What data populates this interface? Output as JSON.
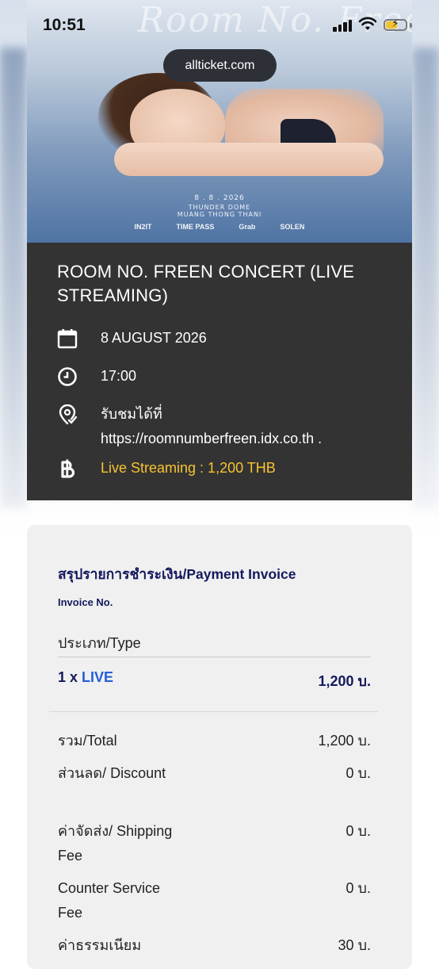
{
  "status_bar": {
    "time": "10:51"
  },
  "browser": {
    "url": "allticket.com"
  },
  "poster": {
    "title_art": "Room No. Freen",
    "date_line1": "8 . 8 . 2026",
    "date_line2": "THUNDER DOME",
    "date_line3": "MUANG THONG THANI",
    "sponsors": [
      "IN2IT",
      "TIME PASS",
      "Grab",
      "SOLEN"
    ]
  },
  "event": {
    "title": "ROOM NO. FREEN CONCERT (LIVE STREAMING)",
    "date": "8 AUGUST 2026",
    "time": "17:00",
    "venue_line1": "รับชมได้ที่",
    "venue_line2": "https://roomnumberfreen.idx.co.th .",
    "price": "Live Streaming : 1,200 THB"
  },
  "invoice": {
    "title": "สรุปรายการชำระเงิน/Payment Invoice",
    "invoice_no_label": "Invoice No.",
    "type_label": "ประเภท/Type",
    "item_qty": "1 x ",
    "item_name": "LIVE",
    "item_amount": "1,200 บ.",
    "summary": [
      {
        "label": "รวม/Total",
        "value": "1,200 บ."
      },
      {
        "label": "ส่วนลด/ Discount",
        "value": "0 บ."
      },
      {
        "label": "ค่าจัดส่ง/ Shipping Fee",
        "value": "0 บ."
      },
      {
        "label": "Counter Service Fee",
        "value": "0 บ."
      },
      {
        "label": "ค่าธรรมเนียม",
        "value": "30 บ."
      }
    ]
  },
  "colors": {
    "card_dark": "#333333",
    "price_accent": "#f7c331",
    "invoice_navy": "#14195c",
    "live_blue": "#245fd6"
  }
}
